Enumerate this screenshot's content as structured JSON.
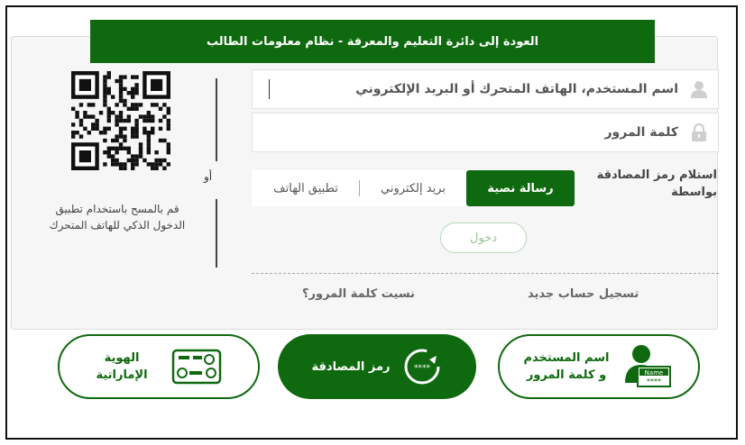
{
  "banner": {
    "text": "العودة إلى دائرة التعليم والمعرفة - نظام معلومات الطالب"
  },
  "form": {
    "username_placeholder": "اسم المستخدم، الهاتف المتحرك أو البريد الإلكتروني",
    "password_placeholder": "كلمة المرور",
    "otp_label": "استلام رمز المصادقة بواسطة",
    "otp_options": [
      "رسالة نصية",
      "بريد إلكتروني",
      "تطبيق الهاتف"
    ],
    "otp_selected": "رسالة نصية",
    "login_button": "دخول",
    "register_link": "تسجيل حساب جديد",
    "forgot_link": "نسيت كلمة المرور؟"
  },
  "qr": {
    "or_label": "أو",
    "instruction": "قم بالمسح باستخدام تطبيق الدخول الذكي للهاتف المتحرك"
  },
  "login_methods": [
    {
      "line1": "اسم المستخدم",
      "line2": "و كلمة المرور",
      "icon": "user-card-icon",
      "name_tag": "Name",
      "pin_mask": "****"
    },
    {
      "line1": "رمز المصادقة",
      "icon": "otp-refresh-icon",
      "pin_mask": "****"
    },
    {
      "line1": "الهوية",
      "line2": "الإماراتية",
      "icon": "emirates-id-icon"
    }
  ],
  "colors": {
    "brand_green": "#0f6a0f",
    "light_green": "#b9d8b9"
  }
}
